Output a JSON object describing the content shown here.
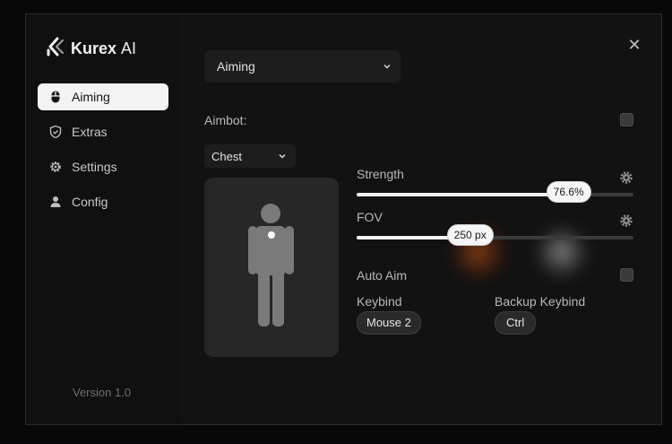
{
  "brand": {
    "name_bold": "Kurex",
    "name_light": "AI"
  },
  "sidebar": {
    "items": [
      {
        "label": "Aiming",
        "icon": "mouse-icon",
        "active": true
      },
      {
        "label": "Extras",
        "icon": "shield-icon",
        "active": false
      },
      {
        "label": "Settings",
        "icon": "gear-icon",
        "active": false
      },
      {
        "label": "Config",
        "icon": "user-icon",
        "active": false
      }
    ],
    "version": "Version 1.0"
  },
  "main": {
    "section_select": {
      "value": "Aiming"
    },
    "aimbot": {
      "label": "Aimbot:",
      "checked": false
    },
    "target_select": {
      "value": "Chest"
    },
    "strength": {
      "label": "Strength",
      "value_text": "76.6%",
      "fraction": 0.766
    },
    "fov": {
      "label": "FOV",
      "value_text": "250 px",
      "fraction": 0.41
    },
    "auto_aim": {
      "label": "Auto Aim",
      "checked": false
    },
    "keybind": {
      "label": "Keybind",
      "value": "Mouse 2"
    },
    "backup_keybind": {
      "label": "Backup Keybind",
      "value": "Ctrl"
    }
  },
  "colors": {
    "background": "#121212",
    "accent": "#f3f3f3",
    "panel": "#272727"
  }
}
